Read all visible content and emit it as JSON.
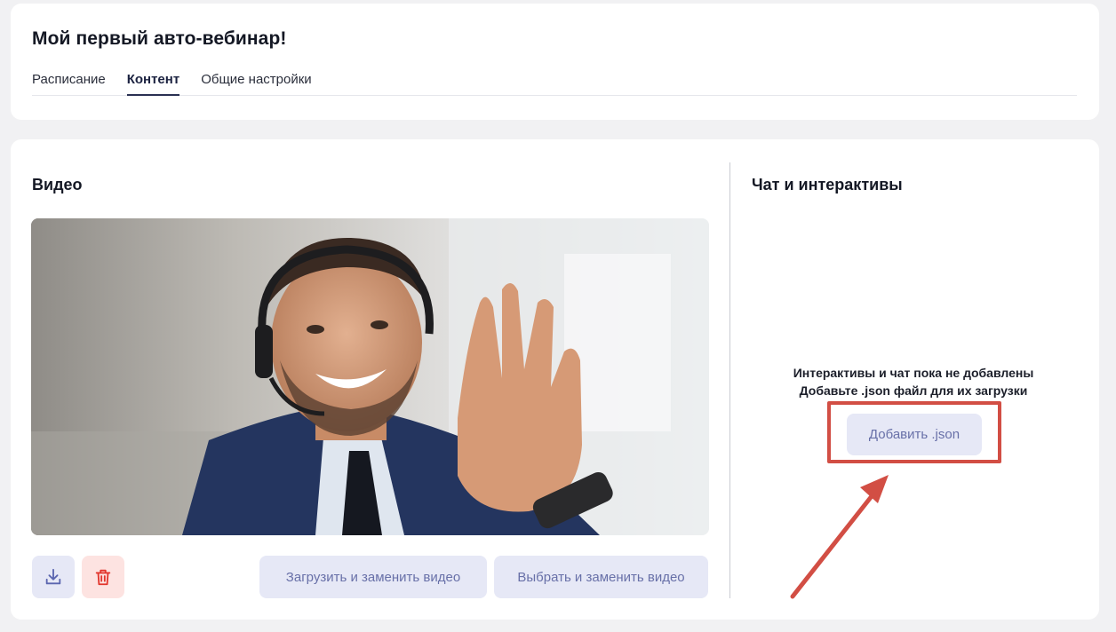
{
  "page": {
    "title": "Мой первый авто-вебинар!"
  },
  "tabs": [
    {
      "label": "Расписание",
      "active": false
    },
    {
      "label": "Контент",
      "active": true
    },
    {
      "label": "Общие настройки",
      "active": false
    }
  ],
  "video_section": {
    "title": "Видео",
    "download_icon": "download-icon",
    "delete_icon": "trash-icon",
    "upload_replace_label": "Загрузить и заменить видео",
    "choose_replace_label": "Выбрать и заменить видео"
  },
  "chat_section": {
    "title": "Чат и интерактивы",
    "empty_line1": "Интерактивы и чат пока не добавлены",
    "empty_line2": "Добавьте .json файл для их загрузки",
    "add_json_label": "Добавить .json"
  },
  "colors": {
    "accent_button_bg": "#e6e8f6",
    "accent_button_text": "#6870a8",
    "danger_bg": "#fde3e1",
    "danger_icon": "#e2362d",
    "annotation": "#d24e44"
  }
}
